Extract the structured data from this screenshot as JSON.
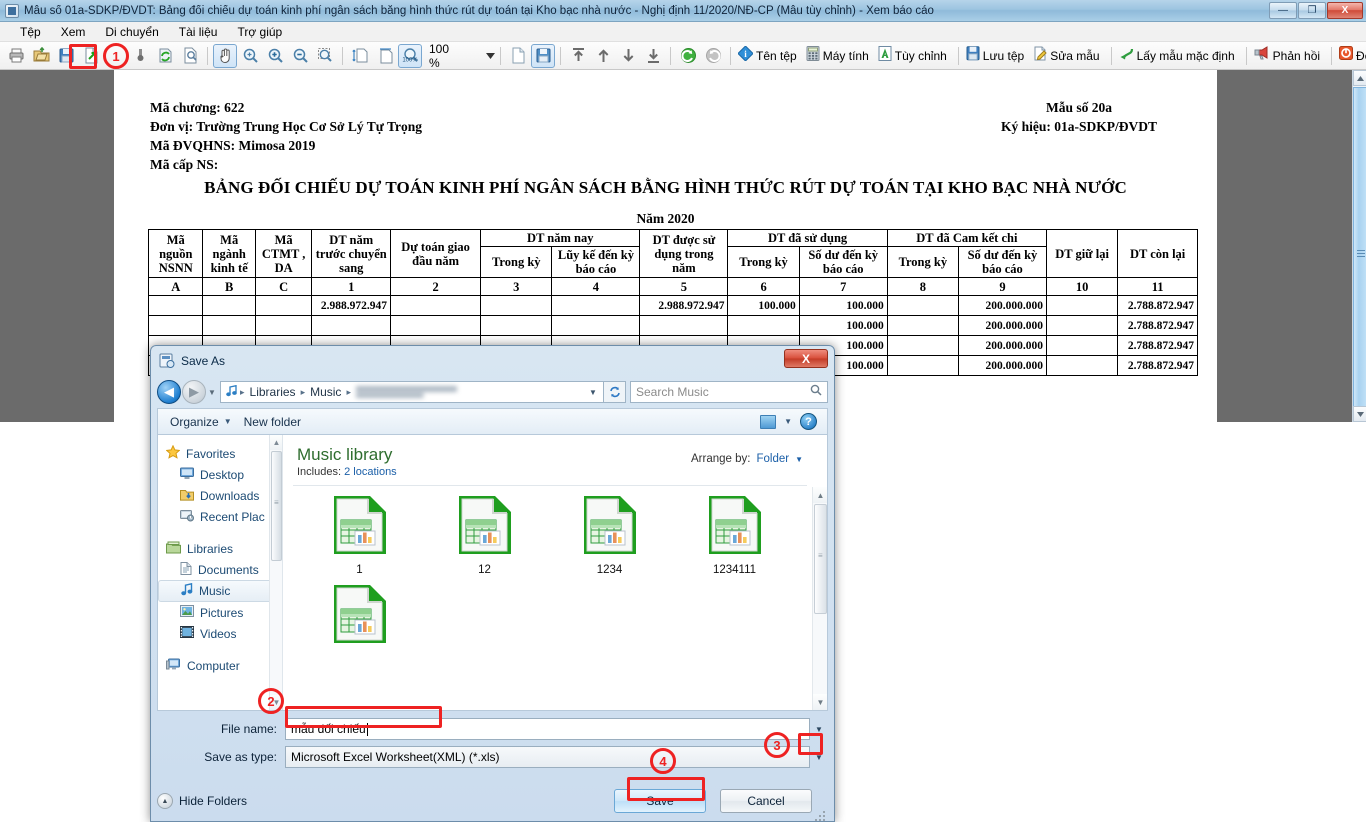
{
  "window": {
    "title": "Mẫu số 01a-SDKP/ĐVDT: Bảng đối chiếu dự toán kinh phí ngân sách bằng hình thức rút dự toán tại Kho bạc nhà nước - Nghị định 11/2020/NĐ-CP (Mẫu tùy chỉnh) - Xem báo cáo",
    "minimize": "—",
    "maximize": "❐",
    "close": "X"
  },
  "menu": {
    "items": [
      {
        "label": "Tệp"
      },
      {
        "label": "Xem"
      },
      {
        "label": "Di chuyển"
      },
      {
        "label": "Tài liệu"
      },
      {
        "label": "Trợ giúp"
      }
    ]
  },
  "toolbar": {
    "zoom_value": "100 %",
    "labeled_buttons": [
      {
        "label": "Tên tệp",
        "icon": "info-icon"
      },
      {
        "label": "Máy tính",
        "icon": "calculator-icon"
      },
      {
        "label": "Tùy chỉnh",
        "icon": "customize-icon"
      },
      {
        "label": "Lưu tệp",
        "icon": "save-icon"
      },
      {
        "label": "Sửa mẫu",
        "icon": "edit-template-icon"
      },
      {
        "label": "Lấy mẫu mặc định",
        "icon": "default-template-icon"
      },
      {
        "label": "Phản hồi",
        "icon": "feedback-icon"
      },
      {
        "label": "Đóng",
        "icon": "close-round-icon"
      }
    ]
  },
  "document": {
    "header_left": [
      "Mã chương: 622",
      "Đơn vị: Trường Trung Học Cơ Sở Lý Tự Trọng",
      "Mã ĐVQHNS: Mimosa 2019",
      "Mã cấp NS:"
    ],
    "header_right": [
      "Mẫu số 20a",
      "Ký hiệu: 01a-SDKP/ĐVDT"
    ],
    "title": "BẢNG ĐỐI CHIẾU DỰ TOÁN KINH PHÍ NGÂN SÁCH BẰNG HÌNH THỨC RÚT DỰ TOÁN TẠI KHO BẠC NHÀ NƯỚC",
    "year": "Năm 2020",
    "table": {
      "group_headers": [
        {
          "label": "DT năm nay",
          "span": 2
        },
        {
          "label": "DT đã sử dụng",
          "span": 2
        },
        {
          "label": "DT đã Cam kết chi",
          "span": 2
        }
      ],
      "columns": [
        "Mã nguồn NSNN",
        "Mã ngành kinh tế",
        "Mã CTMT , DA",
        "DT năm trước chuyển sang",
        "Dự toán giao đầu năm",
        "Trong kỳ",
        "Lũy kế đến kỳ báo cáo",
        "DT được sử dụng trong năm",
        "Trong kỳ",
        "Số dư đến kỳ báo cáo",
        "Trong kỳ",
        "Số dư đến kỳ báo cáo",
        "DT giữ lại",
        "DT còn lại"
      ],
      "letter_row": [
        "A",
        "B",
        "C",
        "1",
        "2",
        "3",
        "4",
        "5",
        "6",
        "7",
        "8",
        "9",
        "10",
        "11"
      ],
      "rows": [
        [
          "",
          "",
          "",
          "2.988.972.947",
          "",
          "",
          "",
          "2.988.972.947",
          "100.000",
          "100.000",
          "",
          "200.000.000",
          "",
          "2.788.872.947"
        ],
        [
          "",
          "",
          "",
          "",
          "",
          "",
          "",
          "",
          "",
          "100.000",
          "",
          "200.000.000",
          "",
          "2.788.872.947"
        ],
        [
          "",
          "",
          "",
          "",
          "",
          "",
          "",
          "",
          "",
          "100.000",
          "",
          "200.000.000",
          "",
          "2.788.872.947"
        ],
        [
          "",
          "",
          "",
          "",
          "",
          "",
          "",
          "",
          "",
          "100.000",
          "",
          "200.000.000",
          "",
          "2.788.872.947"
        ]
      ]
    }
  },
  "dialog": {
    "title": "Save As",
    "close_label": "X",
    "address": {
      "crumbs": [
        "Libraries",
        "Music"
      ],
      "separator": "▸"
    },
    "search": {
      "placeholder": "Search Music",
      "icon": "search-icon"
    },
    "commandbar": {
      "organize": "Organize",
      "new_folder": "New folder"
    },
    "navpane": {
      "groups": [
        {
          "label": "Favorites",
          "icon": "star-icon",
          "children": [
            {
              "label": "Desktop",
              "icon": "desktop-icon"
            },
            {
              "label": "Downloads",
              "icon": "downloads-icon"
            },
            {
              "label": "Recent Plac",
              "icon": "recent-places-icon"
            }
          ]
        },
        {
          "label": "Libraries",
          "icon": "libraries-icon",
          "children": [
            {
              "label": "Documents",
              "icon": "documents-icon"
            },
            {
              "label": "Music",
              "icon": "music-icon",
              "selected": true
            },
            {
              "label": "Pictures",
              "icon": "pictures-icon"
            },
            {
              "label": "Videos",
              "icon": "videos-icon"
            }
          ]
        },
        {
          "label": "Computer",
          "icon": "computer-icon",
          "children": []
        }
      ]
    },
    "library": {
      "title": "Music library",
      "includes_label": "Includes:",
      "includes_value": "2 locations",
      "arrange_label": "Arrange by:",
      "arrange_value": "Folder"
    },
    "files": [
      {
        "name": "1",
        "icon": "excel-file-icon"
      },
      {
        "name": "12",
        "icon": "excel-file-icon"
      },
      {
        "name": "1234",
        "icon": "excel-file-icon"
      },
      {
        "name": "1234111",
        "icon": "excel-file-icon"
      },
      {
        "name": "",
        "icon": "excel-file-icon"
      }
    ],
    "filename_field": {
      "label": "File name:",
      "value": "mẫu đối chiếu"
    },
    "filetype_field": {
      "label": "Save as type:",
      "value": "Microsoft Excel Worksheet(XML) (*.xls)"
    },
    "hide_folders": "Hide Folders",
    "save_button": "Save",
    "cancel_button": "Cancel"
  },
  "annotations": {
    "markers": [
      "1",
      "2",
      "3",
      "4"
    ],
    "color": "#ee2222"
  }
}
